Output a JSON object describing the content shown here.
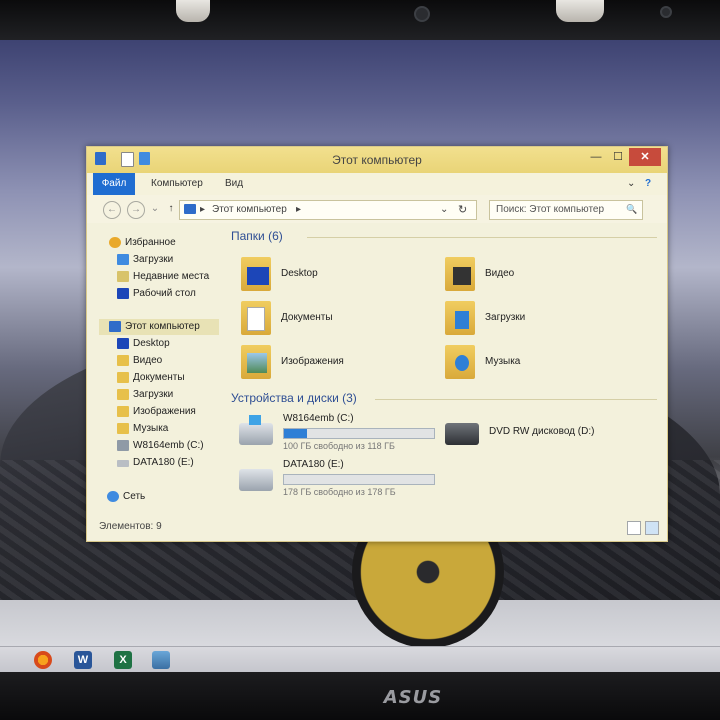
{
  "window": {
    "title": "Этот компьютер",
    "controls": {
      "minimize": "—",
      "maximize": "☐",
      "close": "✕"
    }
  },
  "ribbon": {
    "tabs": [
      "Файл",
      "Компьютер",
      "Вид"
    ],
    "collapse": "⌄",
    "help": "?"
  },
  "address": {
    "back": "←",
    "forward": "→",
    "history": "⌄",
    "up": "↑",
    "separator": "▸",
    "path": "Этот компьютер",
    "dropdown": "⌄",
    "refresh": "↻",
    "search_placeholder": "Поиск: Этот компьютер",
    "search_icon": "🔍"
  },
  "sidebar": {
    "favorites": {
      "label": "Избранное",
      "items": [
        "Загрузки",
        "Недавние места",
        "Рабочий стол"
      ]
    },
    "computer": {
      "label": "Этот компьютер",
      "items": [
        "Desktop",
        "Видео",
        "Документы",
        "Загрузки",
        "Изображения",
        "Музыка",
        "W8164emb (C:)",
        "DATA180 (E:)"
      ]
    },
    "network": {
      "label": "Сеть"
    }
  },
  "folders": {
    "header": "Папки (6)",
    "items": [
      "Desktop",
      "Видео",
      "Документы",
      "Загрузки",
      "Изображения",
      "Музыка"
    ]
  },
  "devices": {
    "header": "Устройства и диски (3)",
    "drives": [
      {
        "name": "W8164emb (C:)",
        "free": "100 ГБ свободно из 118 ГБ",
        "used_fraction": 0.15,
        "bar": true
      },
      {
        "name": "DVD RW дисковод (D:)",
        "bar": false
      },
      {
        "name": "DATA180 (E:)",
        "free": "178 ГБ свободно из 178 ГБ",
        "used_fraction": 0.0,
        "bar": true
      }
    ]
  },
  "status": {
    "items_count": "Элементов: 9"
  },
  "bezel": {
    "logo": "ASUS"
  },
  "colors": {
    "accent": "#1f6dd1",
    "folder": "#e7c04a",
    "drive_fill": "#2e7fd6",
    "window_bg": "#f3f1dc"
  },
  "taskbar": {
    "icons": [
      "firefox-icon",
      "word-icon",
      "excel-icon",
      "remote-desktop-icon"
    ],
    "word_letter": "W",
    "excel_letter": "X"
  }
}
